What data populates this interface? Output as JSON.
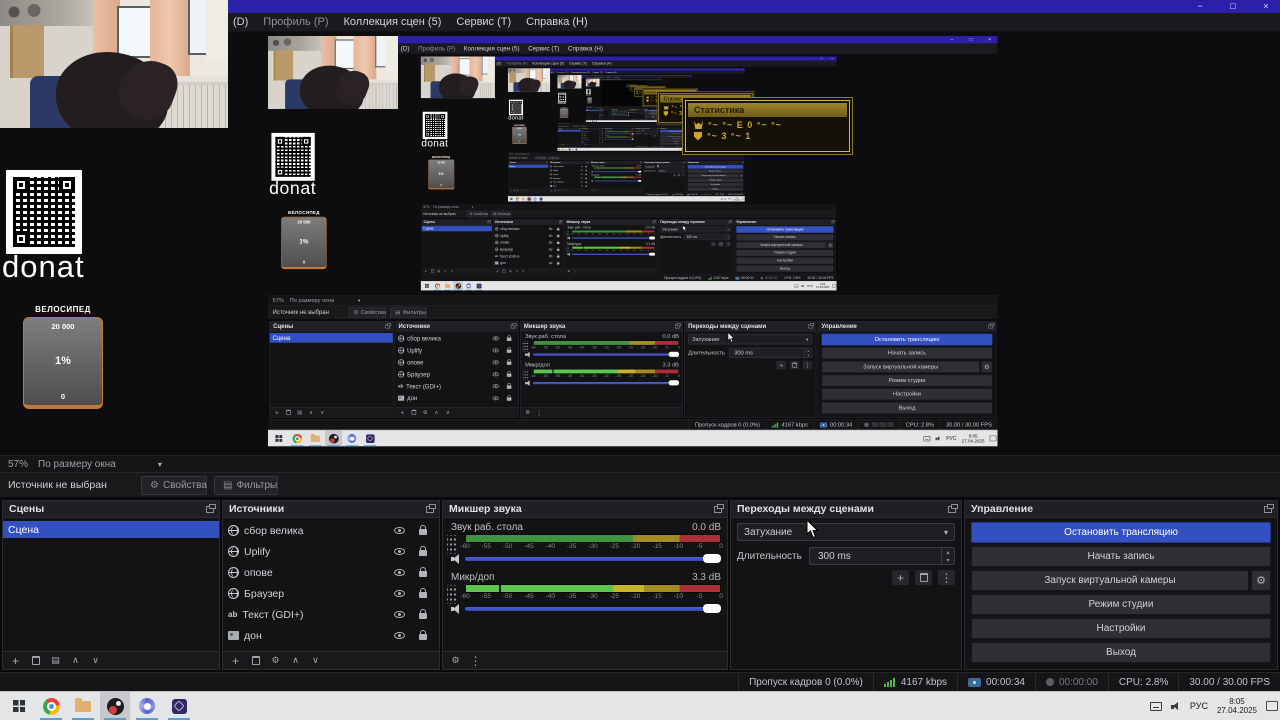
{
  "icons": {
    "minimize": "−",
    "maximize": "□",
    "close": "×",
    "dropdown": "▾",
    "spin_up": "▴",
    "spin_down": "▾",
    "up": "∧",
    "down": "∨",
    "plus": "+",
    "dots": "⋮",
    "gear": "⚙",
    "filter": "▤"
  },
  "window": {
    "menu": [
      {
        "label": "(D)"
      },
      {
        "label": "Профиль (P)",
        "dim": true
      },
      {
        "label": "Коллекция сцен (5)"
      },
      {
        "label": "Сервис (T)"
      },
      {
        "label": "Справка (H)"
      }
    ]
  },
  "preview": {
    "zoom_percent": "57%",
    "zoom_mode": "По размеру окна"
  },
  "source_toolbar": {
    "no_source": "Источник не выбран",
    "properties": "Свойства",
    "filters": "Фильтры"
  },
  "docks": {
    "scenes": {
      "title": "Сцены",
      "items": [
        "Сцена"
      ]
    },
    "sources": {
      "title": "Источники",
      "items": [
        {
          "name": "сбор велика",
          "icon": "browser"
        },
        {
          "name": "Uplify",
          "icon": "browser"
        },
        {
          "name": "опове",
          "icon": "browser"
        },
        {
          "name": "Браузер",
          "icon": "browser"
        },
        {
          "name": "Текст (GDI+)",
          "icon": "text"
        },
        {
          "name": "дон",
          "icon": "image"
        }
      ],
      "text_icon_label": "ab"
    },
    "mixer": {
      "title": "Микшер звука",
      "channels": [
        {
          "name": "Звук раб. стола",
          "db": "0.0 dB"
        },
        {
          "name": "Микр/доп",
          "db": "3.3 dB"
        }
      ],
      "ticks": [
        "-60",
        "-55",
        "-50",
        "-45",
        "-40",
        "-35",
        "-30",
        "-25",
        "-20",
        "-15",
        "-10",
        "-5",
        "0"
      ]
    },
    "transitions": {
      "title": "Переходы между сценами",
      "transition": "Затухание",
      "duration_label": "Длительность",
      "duration_value": "300 ms"
    },
    "controls": {
      "title": "Управление",
      "buttons": [
        "Остановить трансляцию",
        "Начать запись",
        "Запуск виртуальной камеры",
        "Режим студии",
        "Настройки",
        "Выход"
      ]
    }
  },
  "status_bar": {
    "dropped_frames": "Пропуск кадров 0 (0.0%)",
    "bitrate": "4167 kbps",
    "stream_time": "00:00:34",
    "rec_time": "00:00:00",
    "cpu": "CPU: 2.8%",
    "fps": "30.00 / 30.00 FPS"
  },
  "taskbar": {
    "language": "РУС",
    "time": "8:05",
    "date": "27.04.2025"
  },
  "overlays": {
    "donation_text": "donat",
    "goal": {
      "title": "ВЕЛОСИПЕД",
      "target": "20 000",
      "percent": "1%",
      "current": "0"
    },
    "stats": {
      "title": "Статистика",
      "row1": "°~   °~ E 0     °~  °~",
      "row2": "°~   3     °~   1"
    }
  },
  "colors": {
    "titlebar_blue": "#2a21a8",
    "accent_blue": "#3350c0",
    "meter_green": "#5ec64e",
    "meter_yellow": "#c0ad2e",
    "meter_red": "#a83036",
    "stats_gold": "#caa62e",
    "goal_orange": "#c87830"
  }
}
